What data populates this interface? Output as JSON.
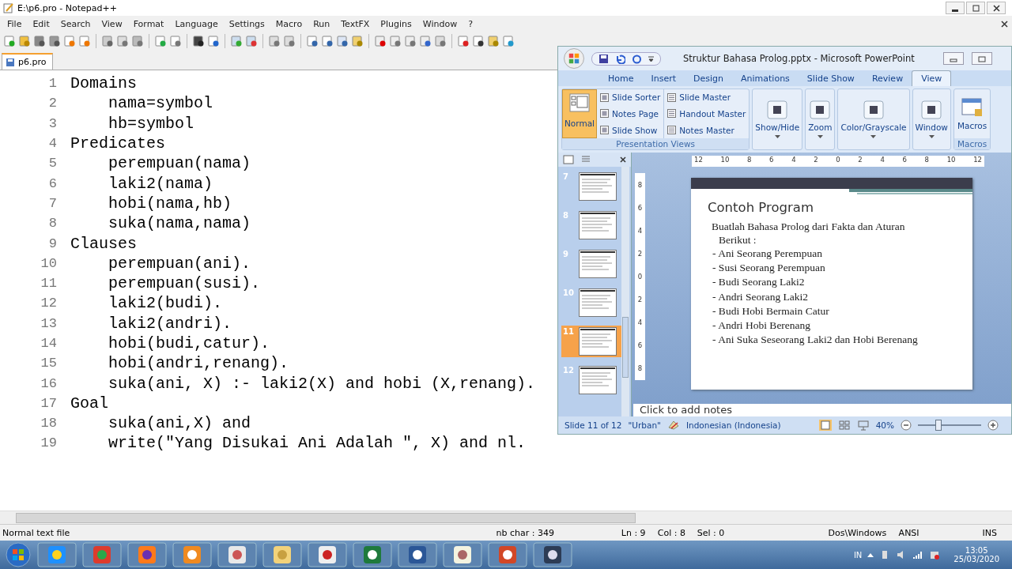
{
  "notepad": {
    "title": "E:\\p6.pro - Notepad++",
    "menu": [
      "File",
      "Edit",
      "Search",
      "View",
      "Format",
      "Language",
      "Settings",
      "Macro",
      "Run",
      "TextFX",
      "Plugins",
      "Window",
      "?"
    ],
    "tab": "p6.pro",
    "code": [
      {
        "line_number": "1",
        "text": "Domains",
        "children": [
          {
            "line_number": "2",
            "text": "nama=symbol"
          },
          {
            "line_number": "3",
            "text": "hb=symbol"
          }
        ]
      },
      {
        "line_number": "4",
        "text": "Predicates",
        "children": [
          {
            "line_number": "5",
            "text": "perempuan(nama)"
          },
          {
            "line_number": "6",
            "text": "laki2(nama)"
          },
          {
            "line_number": "7",
            "text": "hobi(nama,hb)"
          },
          {
            "line_number": "8",
            "text": "suka(nama,nama)"
          }
        ]
      },
      {
        "line_number": "9",
        "text": "Clauses",
        "children": [
          {
            "line_number": "10",
            "text": "perempuan(ani)."
          },
          {
            "line_number": "11",
            "text": "perempuan(susi)."
          },
          {
            "line_number": "12",
            "text": "laki2(budi)."
          },
          {
            "line_number": "13",
            "text": "laki2(andri)."
          },
          {
            "line_number": "14",
            "text": "hobi(budi,catur)."
          },
          {
            "line_number": "15",
            "text": "hobi(andri,renang)."
          },
          {
            "line_number": "16",
            "text": "suka(ani, X) :- laki2(X) and hobi (X,renang)."
          }
        ]
      },
      {
        "line_number": "17",
        "text": "Goal",
        "children": [
          {
            "line_number": "18",
            "text": "suka(ani,X) and"
          },
          {
            "line_number": "19",
            "text": "write(\"Yang Disukai Ani Adalah \", X) and nl."
          }
        ]
      }
    ],
    "status": {
      "file_type": "Normal text file",
      "chars": "nb char : 349",
      "ln": "Ln : 9",
      "col": "Col : 8",
      "sel": "Sel : 0",
      "eol": "Dos\\Windows",
      "encoding": "ANSI",
      "mode": "INS"
    }
  },
  "powerpoint": {
    "title": "Struktur Bahasa Prolog.pptx - Microsoft PowerPoint",
    "tabs": [
      {
        "label": "Home",
        "selected": false
      },
      {
        "label": "Insert",
        "selected": false
      },
      {
        "label": "Design",
        "selected": false
      },
      {
        "label": "Animations",
        "selected": false
      },
      {
        "label": "Slide Show",
        "selected": false
      },
      {
        "label": "Review",
        "selected": false
      },
      {
        "label": "View",
        "selected": true
      }
    ],
    "ribbon": {
      "normal": {
        "label": "Normal",
        "selected": true
      },
      "view_buttons": [
        "Slide Sorter",
        "Notes Page",
        "Slide Show",
        "Slide Master",
        "Handout Master",
        "Notes Master"
      ],
      "views_group": "Presentation Views",
      "big_buttons": [
        "Show/Hide",
        "Zoom",
        "Color/Grayscale",
        "Window"
      ],
      "macros": "Macros",
      "macros_group": "Macros"
    },
    "thumbnails": [
      {
        "number": "7",
        "selected": false
      },
      {
        "number": "8",
        "selected": false
      },
      {
        "number": "9",
        "selected": false
      },
      {
        "number": "10",
        "selected": false
      },
      {
        "number": "11",
        "selected": true
      },
      {
        "number": "12",
        "selected": false
      }
    ],
    "ruler_h": [
      "12",
      "10",
      "8",
      "6",
      "4",
      "2",
      "0",
      "2",
      "4",
      "6",
      "8",
      "10",
      "12"
    ],
    "ruler_v": [
      "8",
      "6",
      "4",
      "2",
      "0",
      "2",
      "4",
      "6",
      "8"
    ],
    "slide": {
      "title": "Contoh Program",
      "intro": "Buatlah Bahasa Prolog dari Fakta dan Aturan Berikut :",
      "bullets": [
        "- Ani Seorang Perempuan",
        "- Susi Seorang Perempuan",
        "- Budi Seorang Laki2",
        "- Andri Seorang Laki2",
        "- Budi Hobi Bermain Catur",
        "- Andri Hobi Berenang",
        "- Ani Suka Seseorang Laki2 dan Hobi Berenang"
      ]
    },
    "notes_placeholder": "Click to add notes",
    "status": {
      "slide": "Slide 11 of 12",
      "theme": "\"Urban\"",
      "language": "Indonesian (Indonesia)",
      "zoom": "40%"
    },
    "zoom_slider": {
      "level": 0.3
    }
  },
  "taskbar": {
    "language": "IN",
    "time": "13:05",
    "date": "25/03/2020"
  }
}
